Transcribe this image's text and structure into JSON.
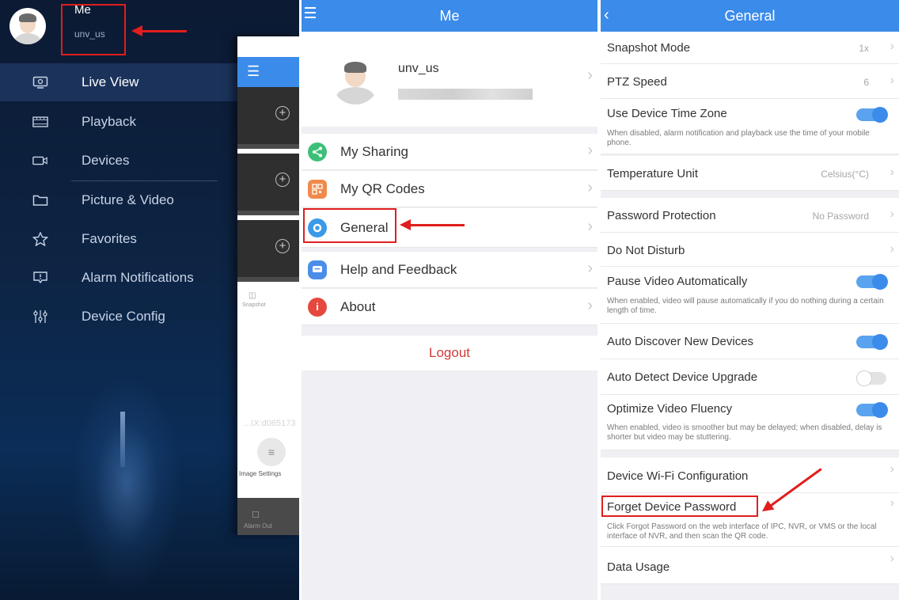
{
  "drawer": {
    "profile_name": "Me",
    "profile_user": "unv_us",
    "items": [
      {
        "label": "Live View",
        "icon": "monitor-icon"
      },
      {
        "label": "Playback",
        "icon": "film-icon"
      },
      {
        "label": "Devices",
        "icon": "camera-icon"
      },
      {
        "label": "Picture & Video",
        "icon": "folder-icon"
      },
      {
        "label": "Favorites",
        "icon": "star-icon"
      },
      {
        "label": "Alarm Notifications",
        "icon": "alarm-icon"
      },
      {
        "label": "Device Config",
        "icon": "sliders-icon"
      }
    ],
    "peek": {
      "snapshot_label": "Snapshot",
      "image_settings_label": "Image Settings",
      "alarm_out_label": "Alarm Out",
      "watermark": "...IX:d065173"
    }
  },
  "me": {
    "title": "Me",
    "username": "unv_us",
    "menu": [
      {
        "label": "My Sharing",
        "color": "#3dbf7a",
        "glyph": "<"
      },
      {
        "label": "My QR Codes",
        "color": "#f08a4b",
        "glyph": "▦"
      },
      {
        "label": "General",
        "color": "#3b9ae8",
        "glyph": "◎"
      },
      {
        "label": "Help and Feedback",
        "color": "#4a8ee8",
        "glyph": "▭"
      },
      {
        "label": "About",
        "color": "#e5483e",
        "glyph": "i"
      }
    ],
    "logout": "Logout"
  },
  "general": {
    "title": "General",
    "rows": {
      "snapshot_mode": {
        "label": "Snapshot Mode",
        "value": "1x"
      },
      "ptz_speed": {
        "label": "PTZ Speed",
        "value": "6"
      },
      "device_time_zone": {
        "label": "Use Device Time Zone",
        "desc": "When disabled, alarm notification and playback use the time of your mobile phone."
      },
      "temperature_unit": {
        "label": "Temperature Unit",
        "value": "Celsius(°C)"
      },
      "password_protection": {
        "label": "Password Protection",
        "value": "No Password"
      },
      "do_not_disturb": {
        "label": "Do Not Disturb"
      },
      "pause_video": {
        "label": "Pause Video Automatically",
        "desc": "When enabled, video will pause automatically if you do nothing during a certain length of time."
      },
      "auto_discover": {
        "label": "Auto Discover New Devices"
      },
      "auto_upgrade": {
        "label": "Auto Detect Device Upgrade"
      },
      "optimize_fluency": {
        "label": "Optimize Video Fluency",
        "desc": "When enabled, video is smoother but may be delayed; when disabled, delay is shorter but video may be stuttering."
      },
      "wifi_config": {
        "label": "Device Wi-Fi Configuration"
      },
      "forget_password": {
        "label": "Forget Device Password",
        "desc": "Click Forgot Password on the web interface of IPC, NVR, or VMS or the local interface of NVR, and then scan the QR code."
      },
      "data_usage": {
        "label": "Data Usage"
      }
    }
  }
}
